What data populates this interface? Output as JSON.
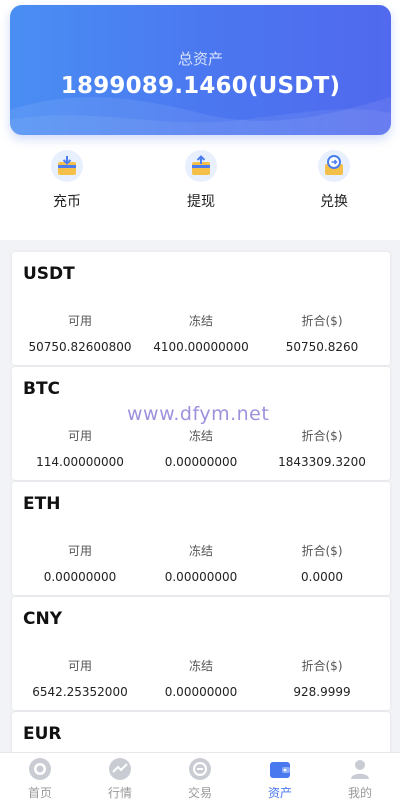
{
  "header": {
    "label": "总资产",
    "amount": "1899089.1460(USDT)"
  },
  "actions": [
    {
      "label": "充币",
      "icon": "deposit-icon"
    },
    {
      "label": "提现",
      "icon": "withdraw-icon"
    },
    {
      "label": "兑换",
      "icon": "exchange-icon"
    }
  ],
  "assets": [
    {
      "name": "USDT",
      "available_label": "可用",
      "frozen_label": "冻结",
      "value_label": "折合($)",
      "available": "50750.82600800",
      "frozen": "4100.00000000",
      "value": "50750.8260"
    },
    {
      "name": "BTC",
      "available_label": "可用",
      "frozen_label": "冻结",
      "value_label": "折合($)",
      "available": "114.00000000",
      "frozen": "0.00000000",
      "value": "1843309.3200"
    },
    {
      "name": "ETH",
      "available_label": "可用",
      "frozen_label": "冻结",
      "value_label": "折合($)",
      "available": "0.00000000",
      "frozen": "0.00000000",
      "value": "0.0000"
    },
    {
      "name": "CNY",
      "available_label": "可用",
      "frozen_label": "冻结",
      "value_label": "折合($)",
      "available": "6542.25352000",
      "frozen": "0.00000000",
      "value": "928.9999"
    },
    {
      "name": "EUR"
    }
  ],
  "watermark": "www.dfym.net",
  "tabbar": [
    {
      "label": "首页",
      "icon": "home-icon",
      "active": false
    },
    {
      "label": "行情",
      "icon": "market-icon",
      "active": false
    },
    {
      "label": "交易",
      "icon": "trade-icon",
      "active": false
    },
    {
      "label": "资产",
      "icon": "wallet-icon",
      "active": true
    },
    {
      "label": "我的",
      "icon": "profile-icon",
      "active": false
    }
  ],
  "colors": {
    "banner_start": "#4a8ef3",
    "banner_end": "#5169ee",
    "active_tab": "#4a78ee",
    "inactive_tab": "#999999"
  }
}
